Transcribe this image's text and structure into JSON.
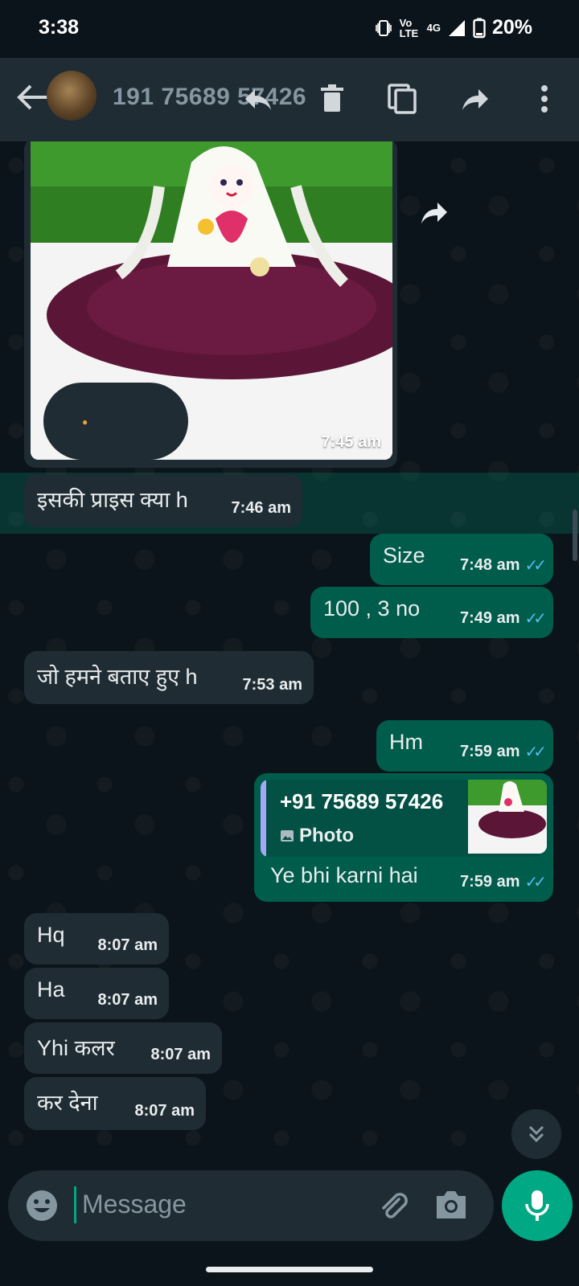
{
  "status_bar": {
    "time": "3:38",
    "volte": "Vo LTE",
    "network": "4G",
    "battery": "20%"
  },
  "header": {
    "contact": "191 75689 57426",
    "icons": [
      "back-arrow-icon",
      "reply-icon",
      "delete-icon",
      "copy-icon",
      "forward-icon",
      "more-vert-icon"
    ]
  },
  "messages": [
    {
      "type": "image",
      "direction": "incoming",
      "time": "7:45 am"
    },
    {
      "type": "text",
      "direction": "incoming",
      "text": "इसकी प्राइस क्या h",
      "time": "7:46 am",
      "selected": true
    },
    {
      "type": "text",
      "direction": "outgoing",
      "text": "Size",
      "time": "7:48 am"
    },
    {
      "type": "text",
      "direction": "outgoing",
      "text": "100 , 3 no",
      "time": "7:49 am"
    },
    {
      "type": "text",
      "direction": "incoming",
      "text": "जो हमने बताए हुए h",
      "time": "7:53 am"
    },
    {
      "type": "text",
      "direction": "outgoing",
      "text": "Hm",
      "time": "7:59 am"
    },
    {
      "type": "reply",
      "direction": "outgoing",
      "quote_sender": "+91 75689 57426",
      "quote_kind": "Photo",
      "text": "Ye bhi karni hai",
      "time": "7:59 am"
    },
    {
      "type": "text",
      "direction": "incoming",
      "text": "Hq",
      "time": "8:07 am"
    },
    {
      "type": "text",
      "direction": "incoming",
      "text": "Ha",
      "time": "8:07 am"
    },
    {
      "type": "text",
      "direction": "incoming",
      "text": "Yhi कलर",
      "time": "8:07 am"
    },
    {
      "type": "text",
      "direction": "incoming",
      "text": "कर देना",
      "time": "8:07 am"
    }
  ],
  "input": {
    "placeholder": "Message"
  },
  "colors": {
    "background": "#0b141a",
    "incoming": "#1f2c34",
    "outgoing": "#005c4b",
    "accent": "#00a884",
    "read_ticks": "#53bdeb"
  }
}
